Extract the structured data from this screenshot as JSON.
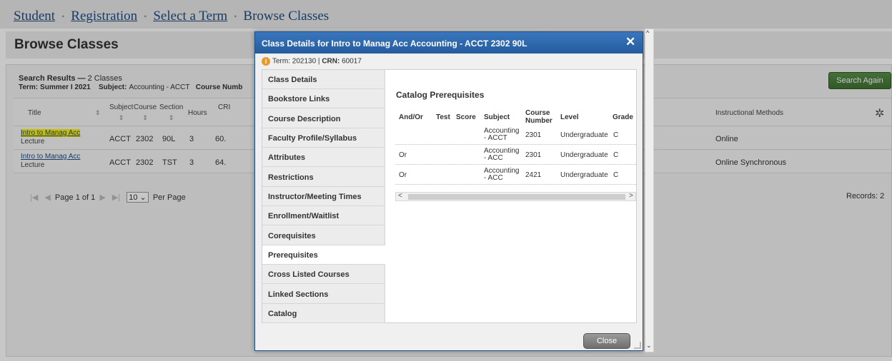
{
  "breadcrumb": {
    "items": [
      "Student",
      "Registration",
      "Select a Term",
      "Browse Classes"
    ],
    "separator": "•"
  },
  "page": {
    "title": "Browse Classes"
  },
  "results": {
    "heading": "Search Results —",
    "count": "2 Classes",
    "term_label": "Term:",
    "term_value": "Summer I 2021",
    "subject_label": "Subject:",
    "subject_value": "Accounting - ACCT",
    "course_label": "Course Numb",
    "search_again": "Search Again",
    "columns": {
      "title": "Title",
      "subject": "Subject",
      "course": "Course",
      "section": "Section",
      "hours": "Hours",
      "crn": "CRI",
      "instructional_methods": "Instructional Methods"
    },
    "rows": [
      {
        "title": "Intro to Manag Acc",
        "type": "Lecture",
        "subject": "ACCT",
        "course": "2302",
        "section": "90L",
        "hours": "3",
        "crn": "60.",
        "method": "Online",
        "highlighted": true
      },
      {
        "title": "Intro to Manag Acc",
        "type": "Lecture",
        "subject": "ACCT",
        "course": "2302",
        "section": "TST",
        "hours": "3",
        "crn": "64.",
        "method": "Online Synchronous",
        "highlighted": false
      }
    ],
    "pager": {
      "page_label": "Page",
      "page": "1",
      "of_label": "of",
      "pages": "1",
      "per_page_value": "10",
      "per_page_label": "Per Page"
    },
    "records": "Records: 2"
  },
  "modal": {
    "title": "Class Details for Intro to Manag Acc Accounting - ACCT 2302 90L",
    "term_label": "Term:",
    "term_value": "202130",
    "crn_label": "CRN:",
    "crn_value": "60017",
    "tabs": [
      "Class Details",
      "Bookstore Links",
      "Course Description",
      "Faculty Profile/Syllabus",
      "Attributes",
      "Restrictions",
      "Instructor/Meeting Times",
      "Enrollment/Waitlist",
      "Corequisites",
      "Prerequisites",
      "Cross Listed Courses",
      "Linked Sections",
      "Catalog"
    ],
    "active_tab": "Prerequisites",
    "pane_title": "Catalog Prerequisites",
    "columns": {
      "andor": "And/Or",
      "test": "Test",
      "score": "Score",
      "subject": "Subject",
      "course_number_1": "Course",
      "course_number_2": "Number",
      "level": "Level",
      "grade": "Grade"
    },
    "prereqs": [
      {
        "andor": "",
        "test": "",
        "score": "",
        "subject_1": "Accounting",
        "subject_2": "- ACCT",
        "course": "2301",
        "level": "Undergraduate",
        "grade": "C"
      },
      {
        "andor": "Or",
        "test": "",
        "score": "",
        "subject_1": "Accounting",
        "subject_2": "- ACC",
        "course": "2301",
        "level": "Undergraduate",
        "grade": "C"
      },
      {
        "andor": "Or",
        "test": "",
        "score": "",
        "subject_1": "Accounting",
        "subject_2": "- ACC",
        "course": "2421",
        "level": "Undergraduate",
        "grade": "C"
      }
    ],
    "close_label": "Close",
    "close_x": "✕"
  },
  "icons": {
    "sort": "⇕",
    "gear": "✲",
    "info": "i",
    "first": "|◀",
    "prev": "◀",
    "next": "▶",
    "last": "▶|",
    "dropdown": "⌄",
    "scroll_left": "<",
    "scroll_right": ">",
    "scroll_up": "^",
    "scroll_down": "⌄"
  }
}
